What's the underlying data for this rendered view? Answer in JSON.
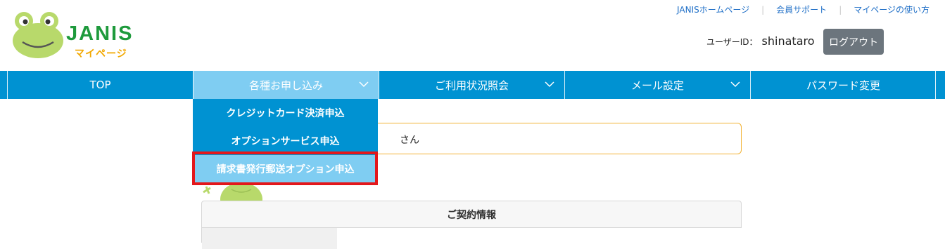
{
  "header": {
    "logo": {
      "name": "JANIS",
      "sub": "マイページ"
    },
    "links": [
      {
        "label": "JANISホームページ"
      },
      {
        "label": "会員サポート"
      },
      {
        "label": "マイページの使い方"
      }
    ],
    "user": {
      "label": "ユーザーID：",
      "value": "shinataro"
    },
    "logout_label": "ログアウト"
  },
  "nav": {
    "items": [
      {
        "label": "TOP",
        "has_dropdown": false,
        "active": false
      },
      {
        "label": "各種お申し込み",
        "has_dropdown": true,
        "active": true
      },
      {
        "label": "ご利用状況照会",
        "has_dropdown": true,
        "active": false
      },
      {
        "label": "メール設定",
        "has_dropdown": true,
        "active": false
      },
      {
        "label": "パスワード変更",
        "has_dropdown": false,
        "active": false
      }
    ]
  },
  "dropdown": {
    "items": [
      {
        "label": "クレジットカード決済申込"
      },
      {
        "label": "オプションサービス申込"
      },
      {
        "label": "請求書発行郵送オプション申込",
        "highlighted": true
      }
    ]
  },
  "greeting": {
    "suffix": "さん"
  },
  "contract": {
    "title": "ご契約情報"
  },
  "colors": {
    "nav_bg": "#0092d2",
    "nav_active": "#7fcdf2",
    "logout_bg": "#6c757d",
    "highlight_border": "#e3171b",
    "greeting_border": "#f2b233"
  }
}
